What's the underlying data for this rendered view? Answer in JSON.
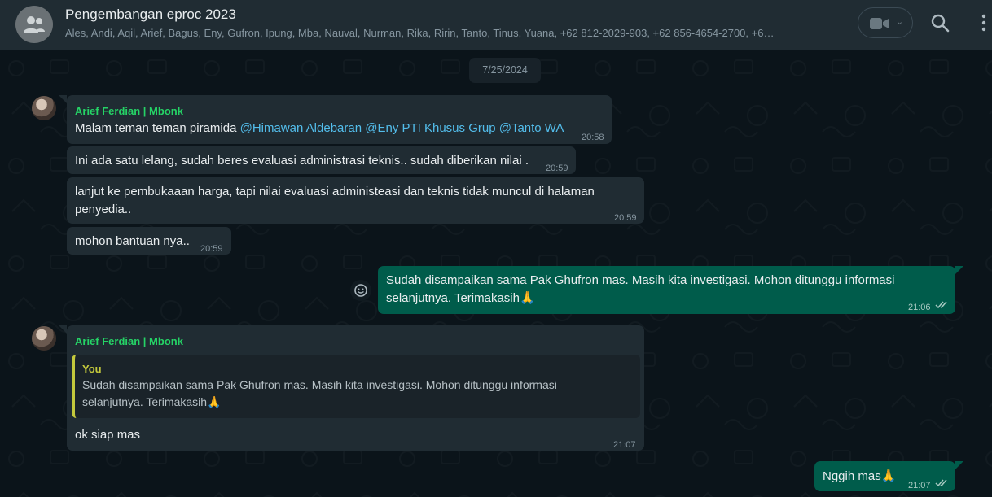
{
  "header": {
    "title": "Pengembangan eproc 2023",
    "members": "Ales, Andi, Aqil, Arief, Bagus, Eny, Gufron, Ipung, Mba, Nauval, Nurman, Rika, Ririn, Tanto, Tinus, Yuana, +62 812-2029-903, +62 856-4654-2700, +6…"
  },
  "date_chip": "7/25/2024",
  "messages": [
    {
      "sender": "Arief Ferdian | Mbonk",
      "text_plain": "Malam teman teman piramida ",
      "mentions": [
        "@Himawan Aldebaran",
        "@Eny PTI Khusus Grup",
        "@Tanto WA"
      ],
      "time": "20:58"
    },
    {
      "text": "Ini ada satu lelang, sudah beres evaluasi administrasi teknis.. sudah diberikan nilai .",
      "time": "20:59"
    },
    {
      "line1": "lanjut ke pembukaaan harga, tapi nilai evaluasi administeasi dan teknis tidak muncul di halaman",
      "line2": "penyedia..",
      "time": "20:59"
    },
    {
      "text": "mohon bantuan nya..",
      "time": "20:59"
    },
    {
      "line1": "Sudah disampaikan sama Pak Ghufron mas. Masih kita investigasi. Mohon ditunggu informasi",
      "line2": "selanjutnya. Terimakasih🙏",
      "time": "21:06"
    },
    {
      "sender": "Arief Ferdian | Mbonk",
      "quote_author": "You",
      "quote_line1": "Sudah disampaikan sama Pak Ghufron mas. Masih kita investigasi. Mohon ditunggu informasi",
      "quote_line2": "selanjutnya. Terimakasih🙏",
      "text": "ok siap mas",
      "time": "21:07"
    },
    {
      "text": "Nggih mas🙏",
      "time": "21:07"
    }
  ],
  "icons": {
    "group_avatar": "group-icon",
    "video": "video-camera-icon",
    "search": "search-icon",
    "menu": "more-vert-icon",
    "emoji_react": "emoji-icon",
    "read_ticks": "double-check-icon"
  },
  "colors": {
    "header_bg": "#202c33",
    "chat_bg": "#0b141a",
    "incoming_bubble": "#202c33",
    "outgoing_bubble": "#005c4b",
    "sender_name": "#25d366",
    "mention": "#53bdeb",
    "quote_accent": "#c4c93c"
  }
}
